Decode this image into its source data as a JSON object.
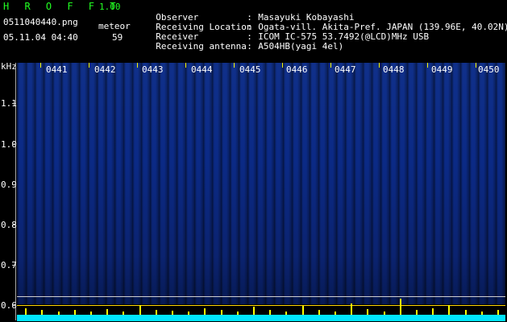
{
  "header": {
    "app_title": "H R O F F T",
    "version": "1.00",
    "filename": "0511040440.png",
    "datetime": "05.11.04 04:40",
    "meteor_label": "meteor",
    "meteor_count": "59"
  },
  "info": [
    {
      "label": "Observer",
      "value": "Masayuki Kobayashi"
    },
    {
      "label": "Receiving Location",
      "value": "Ogata-vill. Akita-Pref. JAPAN (139.96E, 40.02N)"
    },
    {
      "label": "Receiver",
      "value": "ICOM IC-575 53.7492(@LCD)MHz USB"
    },
    {
      "label": "Receiving antenna",
      "value": "A504HB(yagi 4el)"
    }
  ],
  "y_axis": {
    "unit": "kHz",
    "ticks": [
      "1.1",
      "1.0",
      "0.9",
      "0.8",
      "0.7",
      "0.6"
    ]
  },
  "time_axis": {
    "labels": [
      "0441",
      "0442",
      "0443",
      "0444",
      "0445",
      "0446",
      "0447",
      "0448",
      "0449",
      "0450"
    ]
  },
  "colors": {
    "title_green": "#22ff22",
    "spectrogram_blue": "#0b2a86",
    "level_cyan": "#00e5ff",
    "level_yellow": "#ffff00"
  },
  "level_spikes": [
    0.4,
    0.3,
    0.2,
    0.3,
    0.2,
    0.35,
    0.2,
    0.6,
    0.3,
    0.25,
    0.2,
    0.4,
    0.3,
    0.2,
    0.5,
    0.3,
    0.2,
    0.55,
    0.3,
    0.2,
    0.7,
    0.35,
    0.2,
    1.0,
    0.3,
    0.4,
    0.6,
    0.3,
    0.2,
    0.3
  ]
}
